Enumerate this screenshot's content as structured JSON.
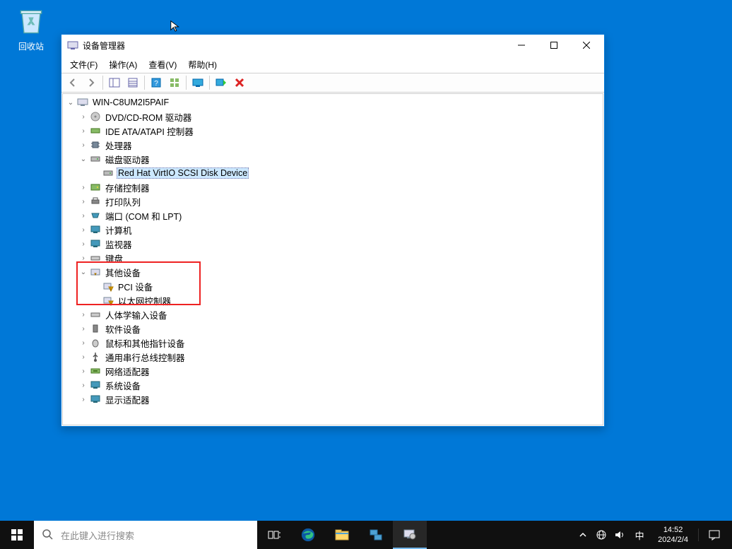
{
  "desktop": {
    "recycle_bin": "回收站"
  },
  "window": {
    "title": "设备管理器",
    "menus": {
      "file": "文件(F)",
      "action": "操作(A)",
      "view": "查看(V)",
      "help": "帮助(H)"
    }
  },
  "tree": {
    "root": "WIN-C8UM2I5PAIF",
    "dvd": "DVD/CD-ROM 驱动器",
    "ide": "IDE ATA/ATAPI 控制器",
    "cpu": "处理器",
    "disk": "磁盘驱动器",
    "disk_child": "Red Hat VirtIO SCSI Disk Device",
    "storage": "存储控制器",
    "printq": "打印队列",
    "ports": "端口 (COM 和 LPT)",
    "computer": "计算机",
    "monitor": "监视器",
    "keyboard": "键盘",
    "other": "其他设备",
    "other_pci": "PCI 设备",
    "other_eth": "以太网控制器",
    "hid": "人体学输入设备",
    "software": "软件设备",
    "mouse": "鼠标和其他指针设备",
    "usb": "通用串行总线控制器",
    "network": "网络适配器",
    "system": "系统设备",
    "display": "显示适配器"
  },
  "taskbar": {
    "search_placeholder": "在此键入进行搜索",
    "ime": "中",
    "time": "14:52",
    "date": "2024/2/4"
  }
}
